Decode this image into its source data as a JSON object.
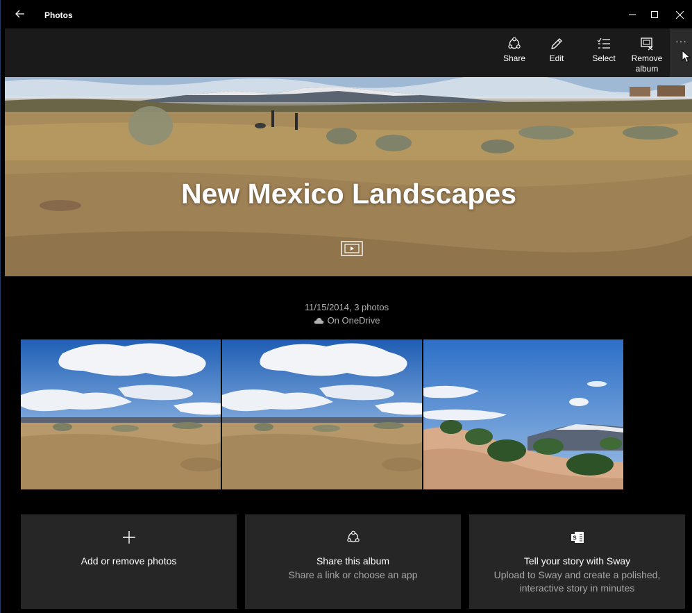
{
  "app": {
    "title": "Photos"
  },
  "window_controls": {
    "minimize": "–",
    "maximize": "□",
    "close": "✕"
  },
  "toolbar": {
    "share_label": "Share",
    "edit_label": "Edit",
    "select_label": "Select",
    "remove_label_line1": "Remove",
    "remove_label_line2": "album",
    "more_label": "···"
  },
  "album": {
    "title": "New Mexico Landscapes",
    "date_count": "11/15/2014, 3 photos",
    "storage": "On OneDrive"
  },
  "photos": [
    {
      "name": "desert-clouds-photo"
    },
    {
      "name": "desert-clouds-photo-2"
    },
    {
      "name": "green-hills-mountains-photo"
    }
  ],
  "tiles": {
    "add": {
      "title": "Add or remove photos"
    },
    "share": {
      "title": "Share this album",
      "subtitle": "Share a link or choose an app"
    },
    "sway": {
      "title": "Tell your story with Sway",
      "subtitle_line1": "Upload to Sway and create a polished,",
      "subtitle_line2": "interactive story in minutes"
    }
  },
  "icons": {
    "back": "back-arrow-icon",
    "share": "share-icon",
    "edit": "pencil-icon",
    "select": "checklist-icon",
    "remove": "remove-album-icon",
    "more": "more-icon",
    "slideshow": "slideshow-icon",
    "cloud": "cloud-icon",
    "add": "plus-icon",
    "sway": "sway-icon"
  },
  "colors": {
    "background": "#000000",
    "commandbar": "#1a1a1a",
    "tile": "#262626",
    "muted_text": "#b3b3b3"
  }
}
